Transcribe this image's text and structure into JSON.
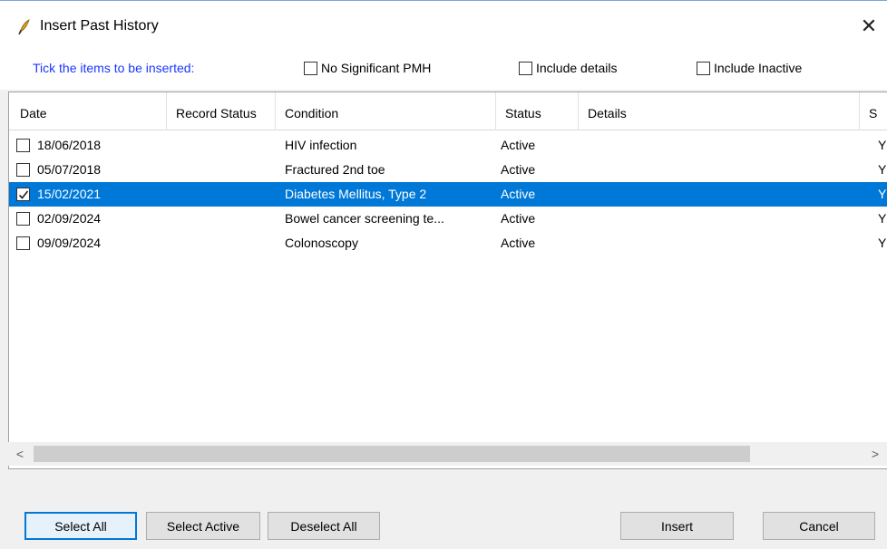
{
  "window": {
    "title": "Insert Past History",
    "close_glyph": "✕"
  },
  "options": {
    "instruction": "Tick the items to be inserted:",
    "no_significant_pmh": "No Significant PMH",
    "include_details": "Include details",
    "include_inactive": "Include Inactive"
  },
  "grid": {
    "columns": [
      "Date",
      "Record Status",
      "Condition",
      "Status",
      "Details",
      "S"
    ],
    "rows": [
      {
        "date": "18/06/2018",
        "record_status": "",
        "condition": "HIV infection",
        "status": "Active",
        "details": "",
        "s": "Y",
        "checked": false,
        "selected": false
      },
      {
        "date": "05/07/2018",
        "record_status": "",
        "condition": "Fractured 2nd toe",
        "status": "Active",
        "details": "",
        "s": "Y",
        "checked": false,
        "selected": false
      },
      {
        "date": "15/02/2021",
        "record_status": "",
        "condition": "Diabetes Mellitus, Type 2",
        "status": "Active",
        "details": "",
        "s": "Y",
        "checked": true,
        "selected": true
      },
      {
        "date": "02/09/2024",
        "record_status": "",
        "condition": "Bowel cancer screening te...",
        "status": "Active",
        "details": "",
        "s": "Y",
        "checked": false,
        "selected": false
      },
      {
        "date": "09/09/2024",
        "record_status": "",
        "condition": "Colonoscopy",
        "status": "Active",
        "details": "",
        "s": "Y",
        "checked": false,
        "selected": false
      }
    ]
  },
  "scrollbar": {
    "left_glyph": "<",
    "right_glyph": ">"
  },
  "buttons": {
    "select_all": "Select All",
    "select_active": "Select Active",
    "deselect_all": "Deselect All",
    "insert": "Insert",
    "cancel": "Cancel"
  },
  "colors": {
    "selection": "#0078d7",
    "instruction_text": "#1a37ff"
  },
  "icons": {
    "app": "quill-pen-icon",
    "close": "close-icon"
  }
}
